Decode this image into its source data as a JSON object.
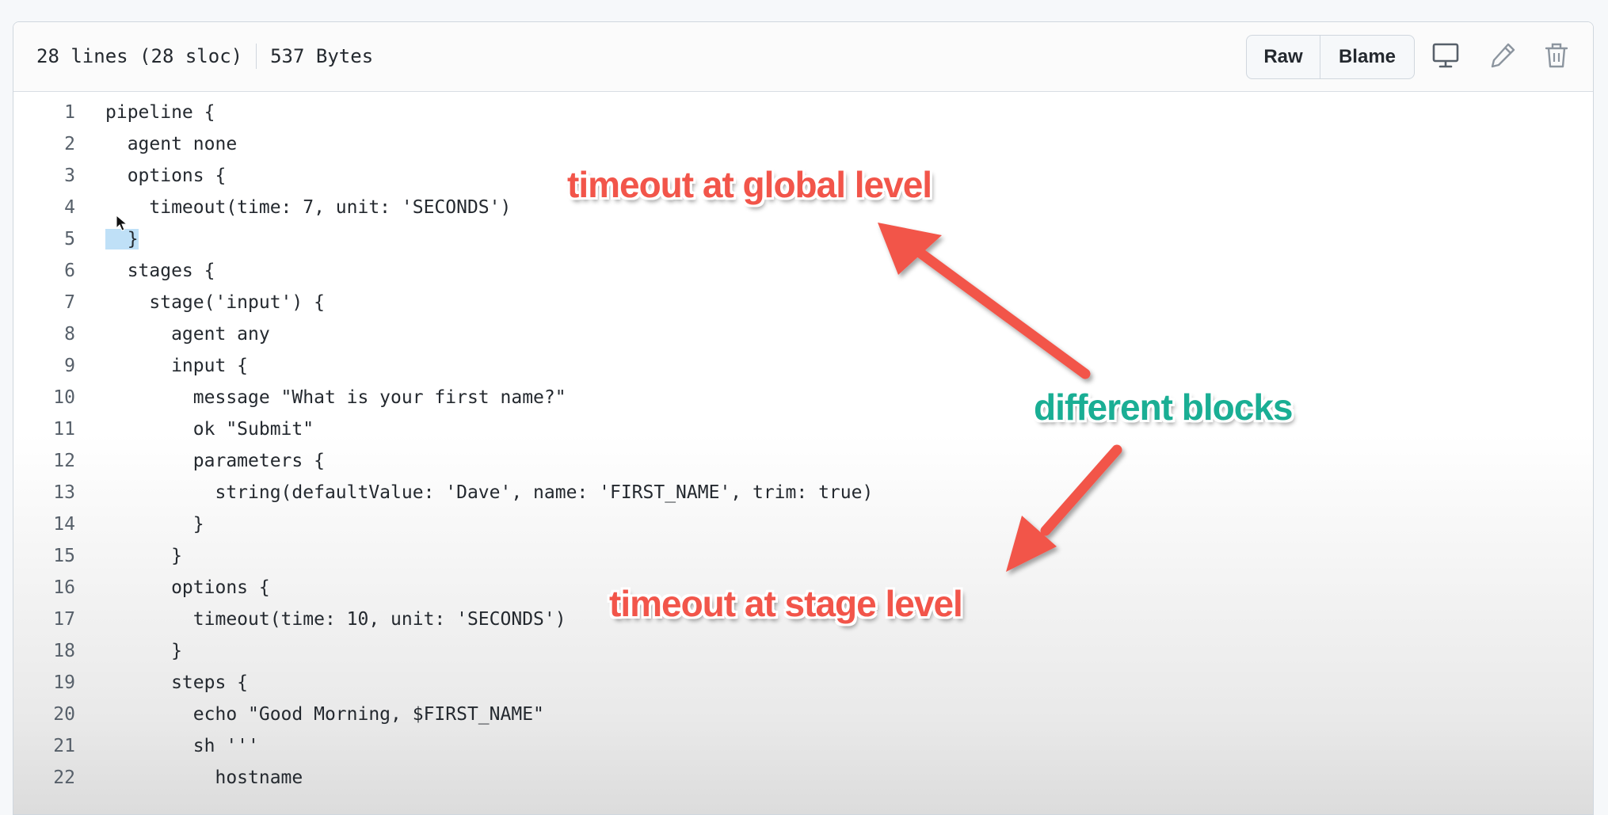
{
  "file_header": {
    "lines_info": "28 lines (28 sloc)",
    "size": "537 Bytes",
    "raw_label": "Raw",
    "blame_label": "Blame",
    "icons": [
      "desktop-icon",
      "pencil-icon",
      "trash-icon"
    ]
  },
  "code_lines": [
    {
      "num": "1",
      "text": "pipeline {"
    },
    {
      "num": "2",
      "text": "  agent none"
    },
    {
      "num": "3",
      "text": "  options {"
    },
    {
      "num": "4",
      "text": "    timeout(time: 7, unit: 'SECONDS')"
    },
    {
      "num": "5",
      "text": "  }"
    },
    {
      "num": "6",
      "text": "  stages {"
    },
    {
      "num": "7",
      "text": "    stage('input') {"
    },
    {
      "num": "8",
      "text": "      agent any"
    },
    {
      "num": "9",
      "text": "      input {"
    },
    {
      "num": "10",
      "text": "        message \"What is your first name?\""
    },
    {
      "num": "11",
      "text": "        ok \"Submit\""
    },
    {
      "num": "12",
      "text": "        parameters {"
    },
    {
      "num": "13",
      "text": "          string(defaultValue: 'Dave', name: 'FIRST_NAME', trim: true)"
    },
    {
      "num": "14",
      "text": "        }"
    },
    {
      "num": "15",
      "text": "      }"
    },
    {
      "num": "16",
      "text": "      options {"
    },
    {
      "num": "17",
      "text": "        timeout(time: 10, unit: 'SECONDS')"
    },
    {
      "num": "18",
      "text": "      }"
    },
    {
      "num": "19",
      "text": "      steps {"
    },
    {
      "num": "20",
      "text": "        echo \"Good Morning, $FIRST_NAME\""
    },
    {
      "num": "21",
      "text": "        sh '''"
    },
    {
      "num": "22",
      "text": "          hostname"
    }
  ],
  "annotations": {
    "global": "timeout at global level",
    "blocks": "different blocks",
    "stage": "timeout at stage level"
  },
  "colors": {
    "annotation_red": "#f2554a",
    "annotation_teal": "#1aae94",
    "selection": "#bfe0f7"
  }
}
